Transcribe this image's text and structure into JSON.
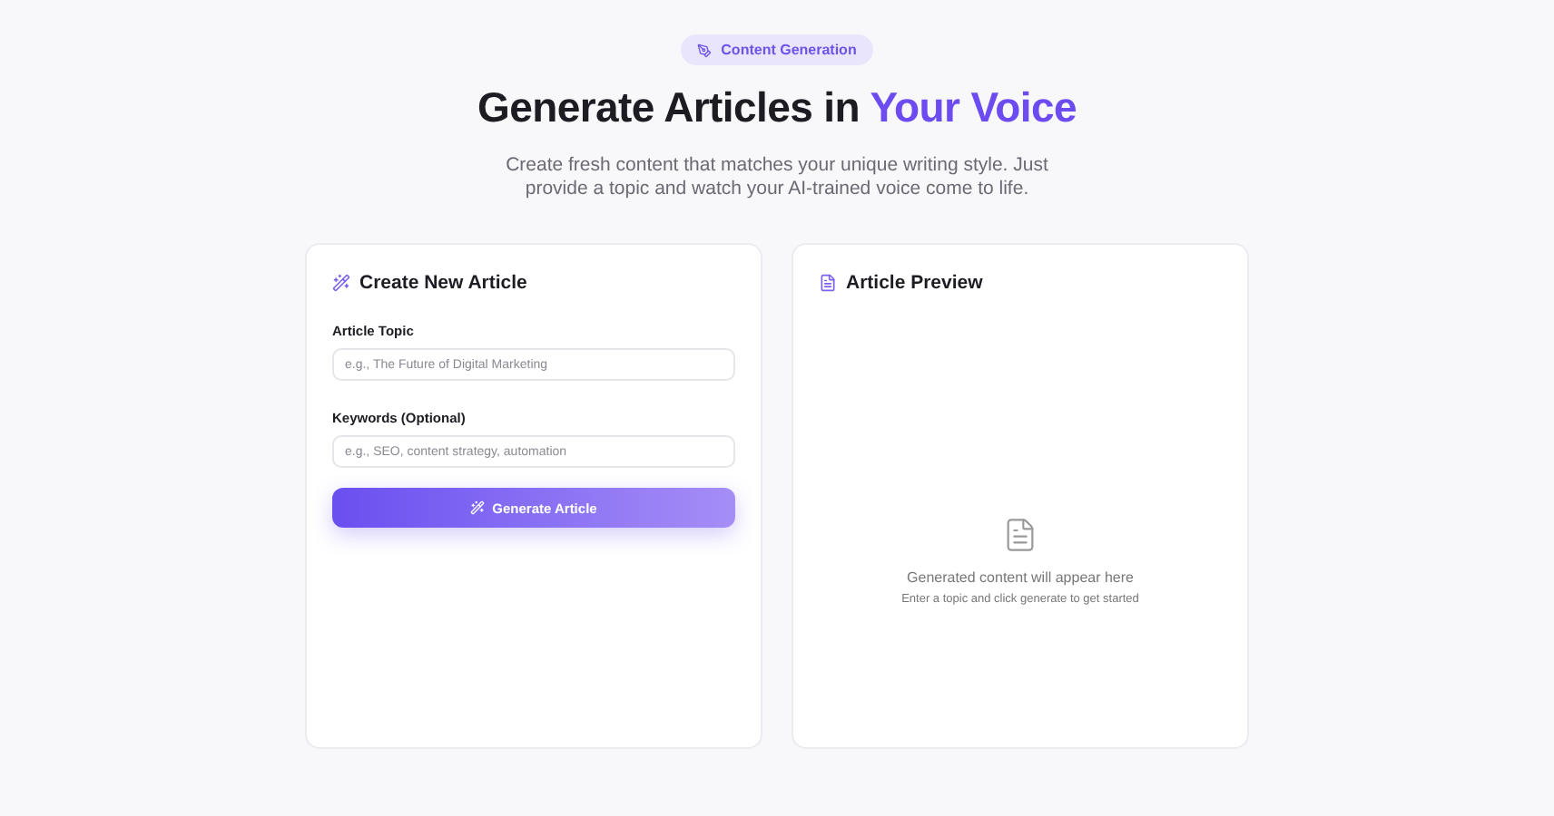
{
  "badge": "Content Generation",
  "title": {
    "text": "Generate Articles in",
    "highlight": "Your Voice"
  },
  "subtitle": "Create fresh content that matches your unique writing style. Just provide a topic and watch your AI-trained voice come to life.",
  "form": {
    "title": "Create New Article",
    "fields": [
      {
        "label": "Article Topic",
        "placeholder": "e.g., The Future of Digital Marketing"
      },
      {
        "label": "Keywords (Optional)",
        "placeholder": "e.g., SEO, content strategy, automation"
      }
    ],
    "button": "Generate Article"
  },
  "preview": {
    "title": "Article Preview",
    "empty_title": "Generated content will appear here",
    "empty_hint": "Enter a topic and click generate to get started"
  }
}
